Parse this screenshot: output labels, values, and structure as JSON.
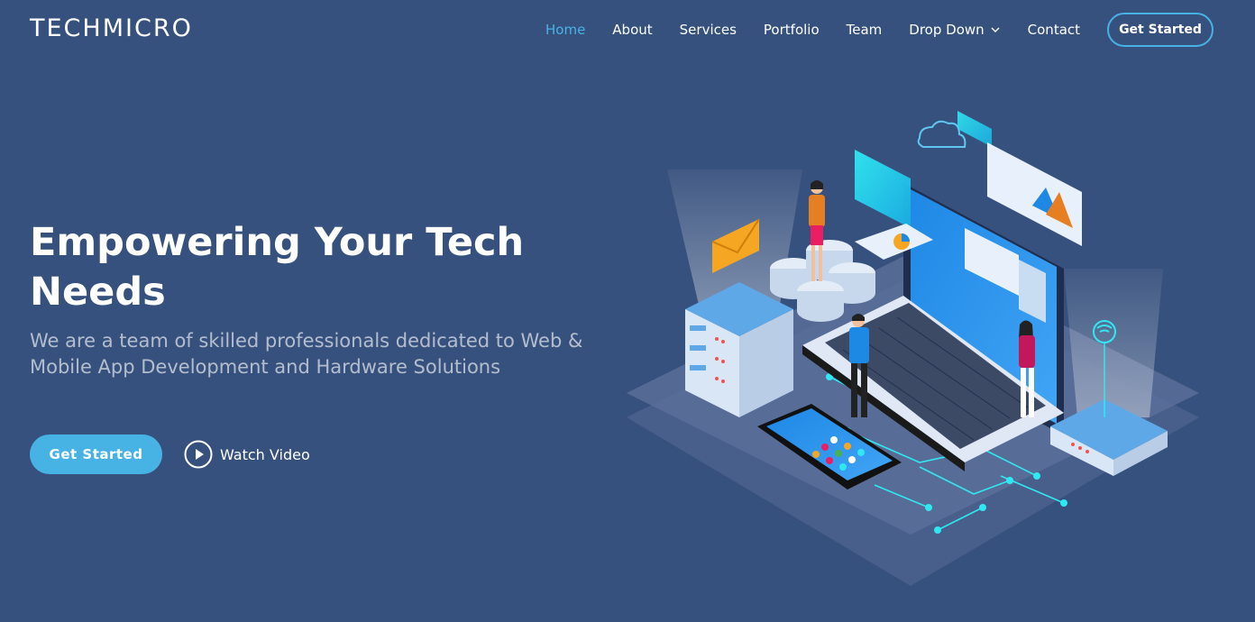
{
  "brand": {
    "logo": "TECHMICRO"
  },
  "nav": {
    "items": [
      {
        "label": "Home",
        "active": true
      },
      {
        "label": "About"
      },
      {
        "label": "Services"
      },
      {
        "label": "Portfolio"
      },
      {
        "label": "Team"
      },
      {
        "label": "Drop Down",
        "icon": "chevron-down-icon"
      },
      {
        "label": "Contact"
      }
    ],
    "cta_label": "Get Started"
  },
  "hero": {
    "title": "Empowering Your Tech Needs",
    "subtitle": "We are a team of skilled professionals dedicated to Web & Mobile App Development and Hardware Solutions",
    "primary_button": "Get Started",
    "video_button": "Watch Video",
    "video_icon": "play-circle-icon"
  },
  "colors": {
    "background": "#37517e",
    "accent": "#47b2e4",
    "text": "#ffffff",
    "cyan": "#30e8f2"
  }
}
